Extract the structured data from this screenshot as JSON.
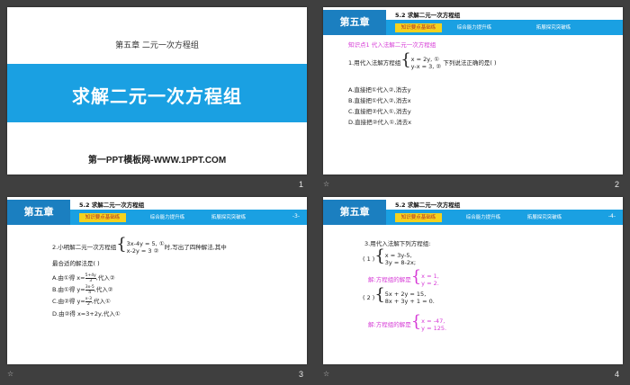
{
  "slides": [
    {
      "page": "1",
      "chapter_line": "第五章  二元一次方程组",
      "title": "求解二元一次方程组",
      "site": "第一PPT模板网-WWW.1PPT.COM"
    },
    {
      "page": "2",
      "header": {
        "chapter": "第五章",
        "section": "5.2  求解二元一次方程组",
        "tabs": [
          "知识要点基础练",
          "综合能力提升练",
          "拓展探究突破练"
        ]
      },
      "knowledge": "知识点1  代入法解二元一次方程组",
      "q1_prefix": "1.用代入法解方程组",
      "q1_eq1": "x = 2y,    ①",
      "q1_eq2": "y-x = 3,    ②",
      "q1_suffix": "下列说法正确的是(     )",
      "options": [
        "A.直接把①代入②,消去y",
        "B.直接把①代入②,消去x",
        "C.直接把②代入①,消去y",
        "D.直接把②代入①,消去x"
      ]
    },
    {
      "page": "3",
      "header": {
        "chapter": "第五章",
        "section": "5.2  求解二元一次方程组",
        "tabs": [
          "知识要点基础练",
          "综合能力提升练",
          "拓展探究突破练"
        ],
        "page_label": "-3-"
      },
      "q2_prefix": "2.小明解二元一次方程组",
      "q2_eq1": "3x-4y = 5,    ①",
      "q2_eq2": "x-2y = 3    ②",
      "q2_suffix": "时,写出了四种解法,其中",
      "q2_line2": "最合适的解法是(     )",
      "optA_pre": "A.由①得 x=",
      "optA_num": "5+4y",
      "optA_den": "3",
      "optA_post": ",代入②",
      "optB_pre": "B.由①得 y=",
      "optB_num": "3x-5",
      "optB_den": "4",
      "optB_post": ",代入②",
      "optC_pre": "C.由②得 y=",
      "optC_num": "x-3",
      "optC_den": "2",
      "optC_post": ",代入①",
      "optD": "D.由②得 x=3+2y,代入①"
    },
    {
      "page": "4",
      "header": {
        "chapter": "第五章",
        "section": "5.2  求解二元一次方程组",
        "tabs": [
          "知识要点基础练",
          "综合能力提升练",
          "拓展探究突破练"
        ],
        "page_label": "-4-"
      },
      "q3_title": "3.用代入法解下列方程组:",
      "p1_label": "( 1 )",
      "p1_eq1": "x = 3y-5,",
      "p1_eq2": "3y = 8-2x;",
      "a1_label": "解:方程组的解是",
      "a1_eq1": "x = 1,",
      "a1_eq2": "y = 2.",
      "p2_label": "( 2 )",
      "p2_eq1": "5x + 2y = 15,",
      "p2_eq2": "8x + 3y + 1 = 0.",
      "a2_label": "解:方程组的解是",
      "a2_eq1": "x = -47,",
      "a2_eq2": "y = 125."
    }
  ],
  "colors": {
    "band": "#1aa0e2",
    "chapter_box": "#1b7fc0",
    "active_tab": "#f4d21e",
    "answer": "#d63ad6"
  }
}
